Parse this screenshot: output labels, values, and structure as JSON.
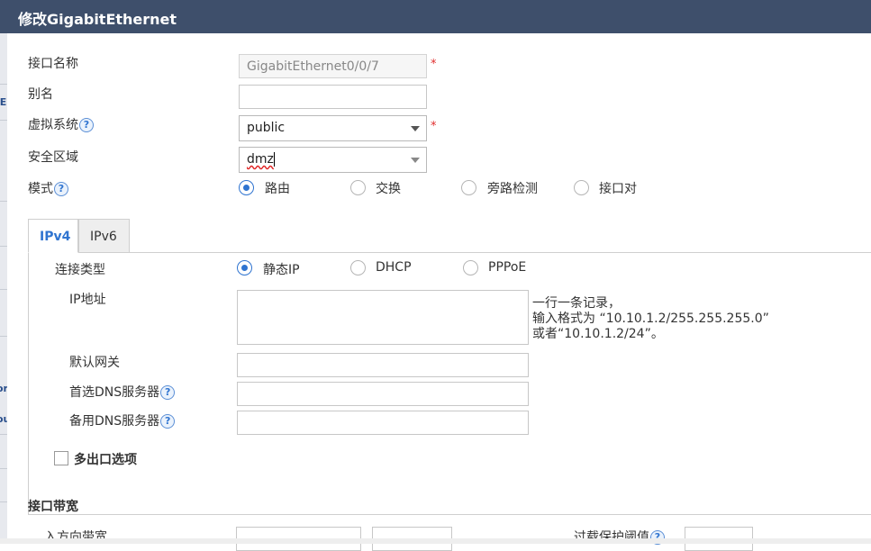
{
  "dialog": {
    "title": "修改GigabitEthernet"
  },
  "background": {
    "fragments": [
      "lE",
      "or",
      "ou"
    ]
  },
  "form": {
    "interface_name": {
      "label": "接口名称",
      "value": "GigabitEthernet0/0/7",
      "required": "*"
    },
    "alias": {
      "label": "别名",
      "value": ""
    },
    "vsys": {
      "label": "虚拟系统",
      "help_icon": "?",
      "value": "public",
      "required": "*"
    },
    "zone": {
      "label": "安全区域",
      "value": "dmz"
    },
    "mode": {
      "label": "模式",
      "help_icon": "?",
      "options": [
        "路由",
        "交换",
        "旁路检测",
        "接口对"
      ],
      "selected": "路由"
    }
  },
  "tabs": [
    {
      "label": "IPv4",
      "active": true
    },
    {
      "label": "IPv6",
      "active": false
    }
  ],
  "ipv4": {
    "connection_type": {
      "label": "连接类型",
      "options": [
        "静态IP",
        "DHCP",
        "PPPoE"
      ],
      "selected": "静态IP"
    },
    "ip_address": {
      "label": "IP地址",
      "value": "",
      "hint_lines": [
        "一行一条记录，",
        "输入格式为 “10.10.1.2/255.255.255.0”",
        "或者“10.10.1.2/24”。"
      ]
    },
    "gateway": {
      "label": "默认网关",
      "value": ""
    },
    "dns_primary": {
      "label": "首选DNS服务器",
      "help_icon": "?",
      "value": ""
    },
    "dns_secondary": {
      "label": "备用DNS服务器",
      "help_icon": "?",
      "value": ""
    },
    "multi_egress": {
      "label": "多出口选项",
      "checked": false
    }
  },
  "bandwidth": {
    "section_title": "接口带宽",
    "inbound_label": "入方向带宽",
    "threshold_label": "过载保护阈值",
    "help_icon": "?"
  },
  "colors": {
    "titlebar": "#3e4f6b",
    "accent": "#2f74d0",
    "required": "#e02d2d"
  }
}
